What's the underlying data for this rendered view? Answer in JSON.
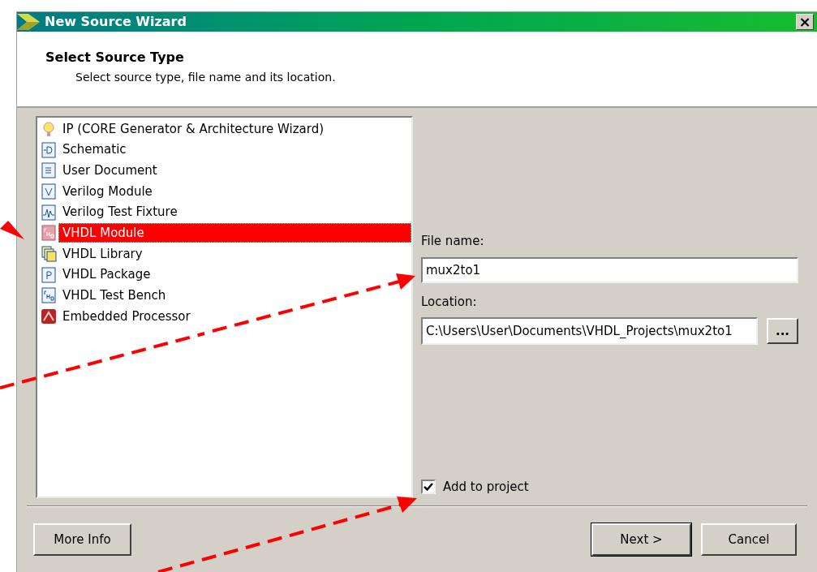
{
  "window": {
    "title": "New Source Wizard",
    "close": "×"
  },
  "header": {
    "title": "Select Source Type",
    "subtitle": "Select source type, file name and its location."
  },
  "source_types": [
    {
      "label": "IP (CORE Generator & Architecture Wizard)",
      "kind": "ip",
      "selected": false
    },
    {
      "label": "Schematic",
      "kind": "schematic",
      "selected": false
    },
    {
      "label": "User Document",
      "kind": "document",
      "selected": false
    },
    {
      "label": "Verilog Module",
      "kind": "verilog",
      "selected": false
    },
    {
      "label": "Verilog Test Fixture",
      "kind": "fixture",
      "selected": false
    },
    {
      "label": "VHDL Module",
      "kind": "vhdl",
      "selected": true
    },
    {
      "label": "VHDL Library",
      "kind": "library",
      "selected": false
    },
    {
      "label": "VHDL Package",
      "kind": "package",
      "selected": false
    },
    {
      "label": "VHDL Test Bench",
      "kind": "bench",
      "selected": false
    },
    {
      "label": "Embedded Processor",
      "kind": "processor",
      "selected": false
    }
  ],
  "file_name": {
    "label": "File name:",
    "value": "mux2to1"
  },
  "location": {
    "label": "Location:",
    "value": "C:\\Users\\User\\Documents\\VHDL_Projects\\mux2to1",
    "browse": "..."
  },
  "add_to_project": {
    "label": "Add to project",
    "checked": true
  },
  "buttons": {
    "more_info": "More Info",
    "next": "Next >",
    "cancel": "Cancel"
  }
}
